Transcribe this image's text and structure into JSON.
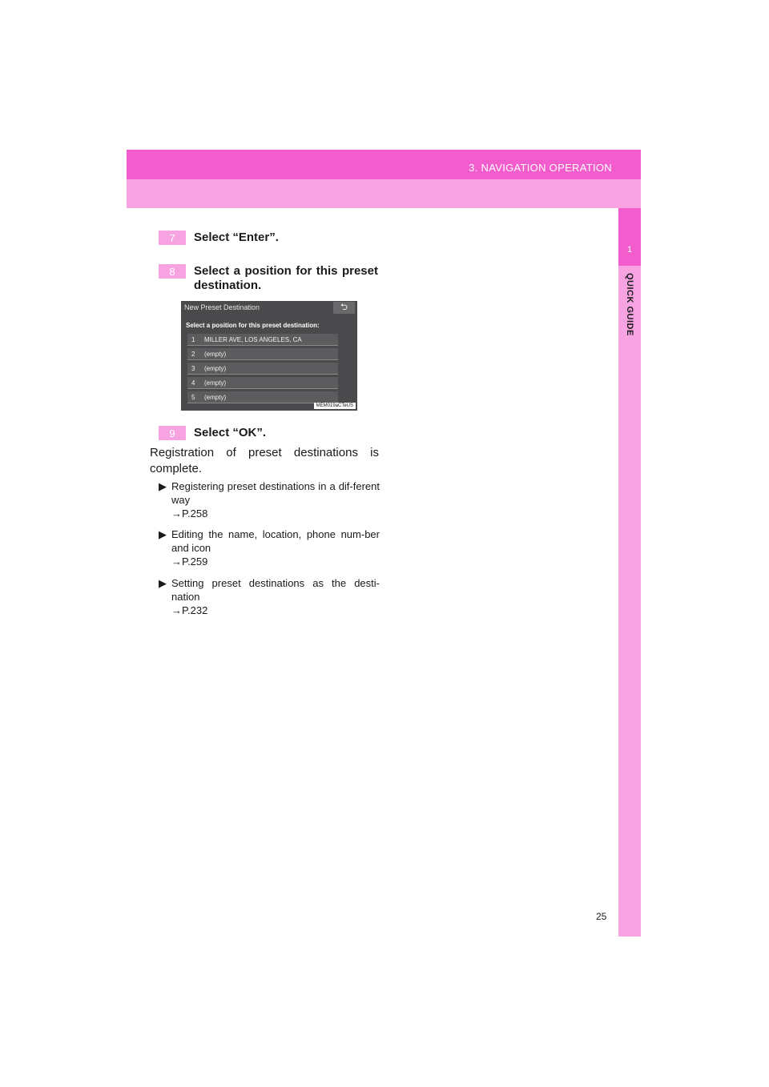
{
  "header": {
    "title": "3. NAVIGATION OPERATION"
  },
  "side": {
    "chapter": "1",
    "label": "QUICK GUIDE"
  },
  "steps": [
    {
      "num": "7",
      "text": "Select “Enter”."
    },
    {
      "num": "8",
      "text": "Select a position for this preset destination."
    },
    {
      "num": "9",
      "text": "Select “OK”."
    }
  ],
  "screen": {
    "title": "New Preset Destination",
    "back": "⮌",
    "prompt": "Select a position for this preset destination:",
    "items": [
      {
        "n": "1",
        "label": "MILLER AVE, LOS ANGELES, CA"
      },
      {
        "n": "2",
        "label": "(empty)"
      },
      {
        "n": "3",
        "label": "(empty)"
      },
      {
        "n": "4",
        "label": "(empty)"
      },
      {
        "n": "5",
        "label": "(empty)"
      }
    ],
    "code": "MEM019aCTeUS"
  },
  "paragraph": "Registration of preset destinations is complete.",
  "bullets": [
    {
      "text": "Registering preset destinations in a dif-ferent way",
      "ref": "→P.258"
    },
    {
      "text": "Editing the name, location, phone num-ber and icon",
      "ref": "→P.259"
    },
    {
      "text": "Setting preset destinations as the desti-nation",
      "ref": "→P.232"
    }
  ],
  "page": "25"
}
